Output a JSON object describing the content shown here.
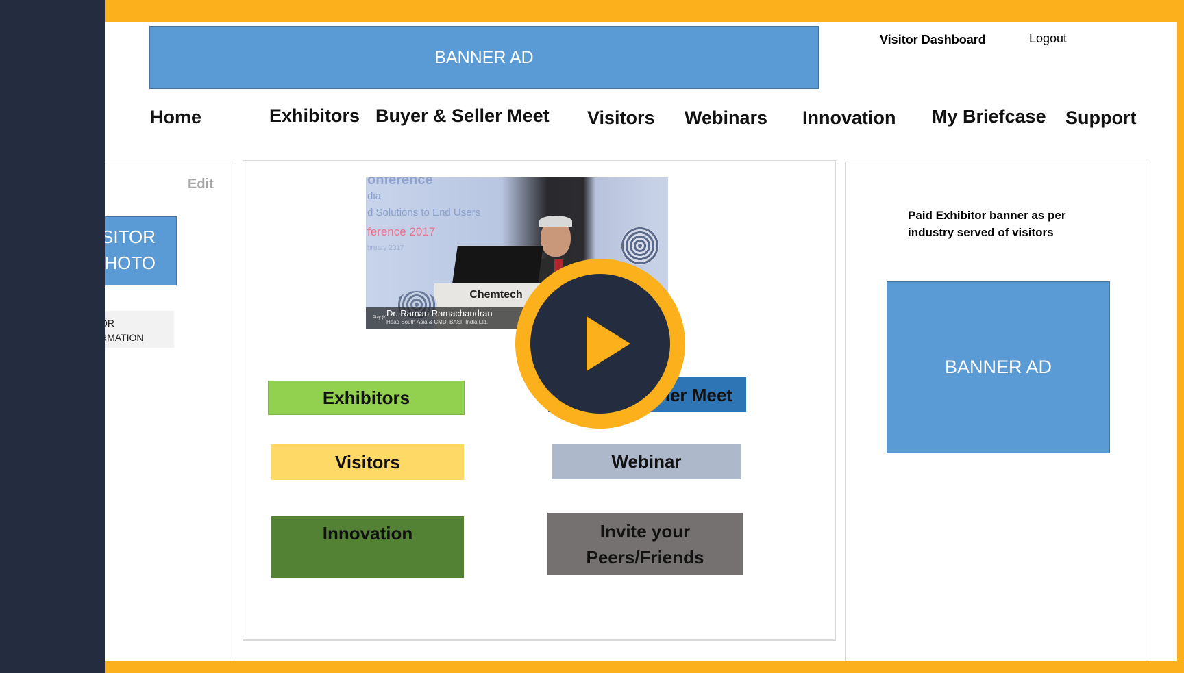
{
  "header": {
    "banner_label": "BANNER AD",
    "dashboard_link": "Visitor Dashboard",
    "logout_link": "Logout"
  },
  "nav": {
    "items": [
      "Home",
      "Exhibitors",
      "Buyer & Seller Meet",
      "Visitors",
      "Webinars",
      "Innovation",
      "My Briefcase",
      "Support"
    ]
  },
  "profile": {
    "edit_label": "Edit",
    "photo_line1": "SITOR",
    "photo_line2": "HOTO",
    "info_line1": "OR",
    "info_line2": "RMATION"
  },
  "video": {
    "slide_line1": "onference",
    "slide_line2": "dia",
    "slide_line3": "d Solutions to End Users",
    "slide_line4": "ference 2017",
    "slide_line5": "bruary 2017",
    "podium_text": "Chemtech",
    "speaker_name": "Dr. Raman Ramachandran",
    "speaker_title": "Head South Asia & CMD, BASF India Ltd.",
    "play_small": "Play (k)"
  },
  "tiles": {
    "exhibitors": "Exhibitors",
    "buyer_seller": "ller Meet",
    "visitors": "Visitors",
    "webinar": "Webinar",
    "innovation": "Innovation",
    "invite_line1": "Invite your",
    "invite_line2": "Peers/Friends"
  },
  "sidebar": {
    "paid_line1": "Paid Exhibitor banner as per",
    "paid_line2": "industry served of visitors",
    "banner_label": "BANNER AD"
  },
  "colors": {
    "frame": "#fbb01c",
    "dark": "#242d40",
    "banner_blue": "#5b9bd5",
    "exhibitors_tile": "#92d050",
    "buyer_tile": "#2e75b6",
    "visitors_tile": "#ffd966",
    "webinar_tile": "#adb9ca",
    "innovation_tile": "#548235",
    "invite_tile": "#767171"
  },
  "icons": {
    "play": "play-icon"
  }
}
